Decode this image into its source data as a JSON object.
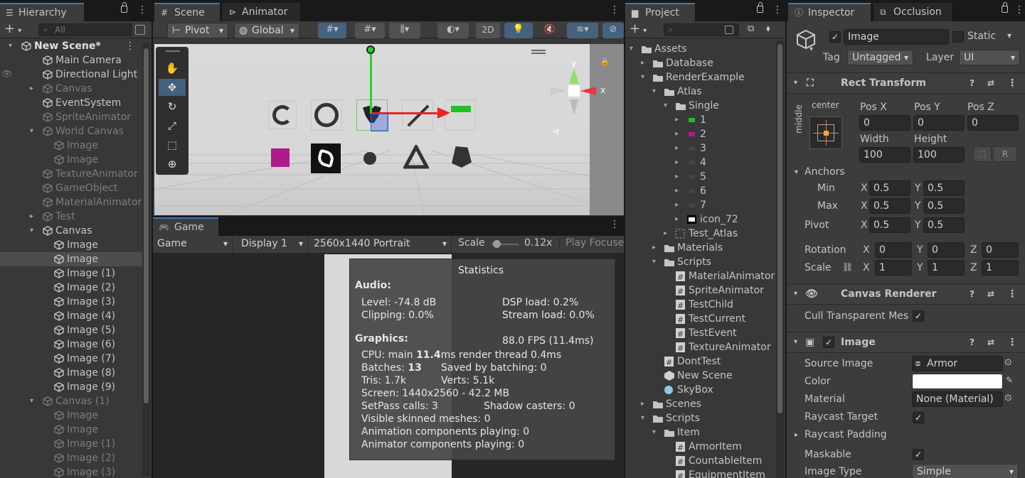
{
  "hierarchy": {
    "tab": "Hierarchy",
    "search_placeholder": "All",
    "rows": [
      {
        "label": "New Scene*",
        "bold": true
      },
      {
        "label": "Main Camera"
      },
      {
        "label": "Directional Light"
      },
      {
        "label": "Canvas",
        "dim": true
      },
      {
        "label": "EventSystem"
      },
      {
        "label": "SpriteAnimator",
        "dim": true
      },
      {
        "label": "World Canvas",
        "dim": true
      },
      {
        "label": "Image",
        "dim": true
      },
      {
        "label": "Image",
        "dim": true
      },
      {
        "label": "TextureAnimator",
        "dim": true
      },
      {
        "label": "GameObject",
        "dim": true
      },
      {
        "label": "MaterialAnimator",
        "dim": true
      },
      {
        "label": "Test",
        "dim": true
      },
      {
        "label": "Canvas"
      },
      {
        "label": "Image"
      },
      {
        "label": "Image",
        "selected": true
      },
      {
        "label": "Image (1)"
      },
      {
        "label": "Image (2)"
      },
      {
        "label": "Image (3)"
      },
      {
        "label": "Image (4)"
      },
      {
        "label": "Image (5)"
      },
      {
        "label": "Image (6)"
      },
      {
        "label": "Image (7)"
      },
      {
        "label": "Image (8)"
      },
      {
        "label": "Image (9)"
      },
      {
        "label": "Canvas (1)",
        "dim": true
      },
      {
        "label": "Image",
        "dim": true
      },
      {
        "label": "Image",
        "dim": true
      },
      {
        "label": "Image (1)",
        "dim": true
      },
      {
        "label": "Image (2)",
        "dim": true
      },
      {
        "label": "Image (3)",
        "dim": true
      }
    ]
  },
  "scene": {
    "tabs": [
      "Scene",
      "Animator"
    ],
    "pivot": "Pivot",
    "global": "Global",
    "mode_2d": "2D",
    "axis_x": "x",
    "axis_y": "y"
  },
  "game": {
    "tab": "Game",
    "mode": "Game",
    "display": "Display 1",
    "resolution": "2560x1440 Portrait",
    "scale_label": "Scale",
    "scale_value": "0.12x",
    "play_focused": "Play Focused"
  },
  "stats": {
    "title": "Statistics",
    "audio_header": "Audio:",
    "level": "Level: -74.8 dB",
    "dsp": "DSP load: 0.2%",
    "clipping": "Clipping: 0.0%",
    "stream": "Stream load: 0.0%",
    "graphics_header": "Graphics:",
    "fps": "88.0 FPS (11.4ms)",
    "cpu_prefix": "CPU: main ",
    "cpu_main": "11.4",
    "cpu_suffix": "ms  render thread 0.4ms",
    "batches_prefix": "Batches: ",
    "batches": "13",
    "saved": "Saved by batching: 0",
    "tris": "Tris: 1.7k",
    "verts": "Verts: 5.1k",
    "screen": "Screen: 1440x2560 - 42.2 MB",
    "setpass": "SetPass calls: 3",
    "shadow": "Shadow casters: 0",
    "skinned": "Visible skinned meshes: 0",
    "animation": "Animation components playing: 0",
    "animator": "Animator components playing: 0"
  },
  "project": {
    "tab": "Project",
    "rows": [
      {
        "label": "Assets",
        "type": "folder",
        "depth": 0,
        "arrow": "open"
      },
      {
        "label": "Database",
        "type": "folder",
        "depth": 1,
        "arrow": "closed"
      },
      {
        "label": "RenderExample",
        "type": "folder",
        "depth": 1,
        "arrow": "open"
      },
      {
        "label": "Atlas",
        "type": "folder",
        "depth": 2,
        "arrow": "open"
      },
      {
        "label": "Single",
        "type": "folder",
        "depth": 3,
        "arrow": "open"
      },
      {
        "label": "1",
        "type": "sprite",
        "depth": 4,
        "arrow": "closed",
        "color": "#1ec01e"
      },
      {
        "label": "2",
        "type": "sprite",
        "depth": 4,
        "arrow": "closed",
        "color": "#b01a8c"
      },
      {
        "label": "3",
        "type": "sprite",
        "depth": 4,
        "arrow": "closed",
        "color": "#444444"
      },
      {
        "label": "4",
        "type": "sprite",
        "depth": 4,
        "arrow": "closed",
        "color": "#444444"
      },
      {
        "label": "5",
        "type": "sprite",
        "depth": 4,
        "arrow": "closed",
        "color": "#444444"
      },
      {
        "label": "6",
        "type": "sprite",
        "depth": 4,
        "arrow": "closed",
        "color": "#444444"
      },
      {
        "label": "7",
        "type": "sprite",
        "depth": 4,
        "arrow": "closed",
        "color": "#444444"
      },
      {
        "label": "icon_72",
        "type": "sprite",
        "depth": 4,
        "arrow": "closed",
        "color": "#000000"
      },
      {
        "label": "Test_Atlas",
        "type": "atlas",
        "depth": 3,
        "arrow": "closed"
      },
      {
        "label": "Materials",
        "type": "folder",
        "depth": 2,
        "arrow": "closed"
      },
      {
        "label": "Scripts",
        "type": "folder",
        "depth": 2,
        "arrow": "open"
      },
      {
        "label": "MaterialAnimator",
        "type": "script",
        "depth": 3
      },
      {
        "label": "SpriteAnimator",
        "type": "script",
        "depth": 3
      },
      {
        "label": "TestChild",
        "type": "script",
        "depth": 3
      },
      {
        "label": "TestCurrent",
        "type": "script",
        "depth": 3
      },
      {
        "label": "TestEvent",
        "type": "script",
        "depth": 3
      },
      {
        "label": "TextureAnimator",
        "type": "script",
        "depth": 3
      },
      {
        "label": "DontTest",
        "type": "script",
        "depth": 2
      },
      {
        "label": "New Scene",
        "type": "scene",
        "depth": 2
      },
      {
        "label": "SkyBox",
        "type": "material",
        "depth": 2
      },
      {
        "label": "Scenes",
        "type": "folder",
        "depth": 1,
        "arrow": "closed"
      },
      {
        "label": "Scripts",
        "type": "folder",
        "depth": 1,
        "arrow": "open"
      },
      {
        "label": "Item",
        "type": "folder",
        "depth": 2,
        "arrow": "open"
      },
      {
        "label": "ArmorItem",
        "type": "script",
        "depth": 3
      },
      {
        "label": "CountableItem",
        "type": "script",
        "depth": 3
      },
      {
        "label": "EquipmentItem",
        "type": "script",
        "depth": 3
      }
    ]
  },
  "inspector": {
    "tabs": [
      "Inspector",
      "Occlusion"
    ],
    "object_name": "Image",
    "static_label": "Static",
    "tag_label": "Tag",
    "tag_value": "Untagged",
    "layer_label": "Layer",
    "layer_value": "UI",
    "rect_transform": {
      "title": "Rect Transform",
      "anchor_h": "center",
      "anchor_v": "middle",
      "pos_x_label": "Pos X",
      "pos_x": "0",
      "pos_y_label": "Pos Y",
      "pos_y": "0",
      "pos_z_label": "Pos Z",
      "pos_z": "0",
      "width_label": "Width",
      "width": "100",
      "height_label": "Height",
      "height": "100",
      "r_button": "R",
      "anchors_label": "Anchors",
      "min_label": "Min",
      "min_x": "0.5",
      "min_y": "0.5",
      "max_label": "Max",
      "max_x": "0.5",
      "max_y": "0.5",
      "pivot_label": "Pivot",
      "pivot_x": "0.5",
      "pivot_y": "0.5",
      "rotation_label": "Rotation",
      "rot_x": "0",
      "rot_y": "0",
      "rot_z": "0",
      "scale_label": "Scale",
      "scale_x": "1",
      "scale_y": "1",
      "scale_z": "1",
      "x": "X",
      "y": "Y",
      "z": "Z"
    },
    "canvas_renderer": {
      "title": "Canvas Renderer",
      "cull_label": "Cull Transparent Mesh"
    },
    "image": {
      "title": "Image",
      "source_label": "Source Image",
      "source_value": "Armor",
      "color_label": "Color",
      "material_label": "Material",
      "material_value": "None (Material)",
      "raycast_label": "Raycast Target",
      "raycast_padding_label": "Raycast Padding",
      "maskable_label": "Maskable",
      "image_type_label": "Image Type",
      "image_type_value": "Simple"
    }
  }
}
